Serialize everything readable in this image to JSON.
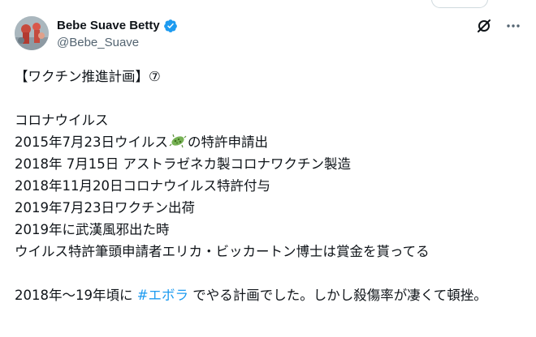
{
  "user": {
    "display_name": "Bebe Suave Betty",
    "handle": "@Bebe_Suave",
    "verified": true
  },
  "actions": {
    "grok_icon": "grok-slash-icon",
    "more_icon": "more-dots-icon"
  },
  "tweet": {
    "line1": "【ワクチン推進計画】⑦",
    "line2": "コロナウイルス",
    "line3_before": "2015年7月23日ウイルス",
    "line3_after": "の特許申請出",
    "line4": "2018年 7月15日 アストラゼネカ製コロナワクチン製造",
    "line5": "2018年11月20日コロナウイルス特許付与",
    "line6": "2019年7月23日ワクチン出荷",
    "line7": "2019年に武漢風邪出た時",
    "line8": "ウイルス特許筆頭申請者エリカ・ビッカートン博士は賞金を貰ってる",
    "line9_before": "2018年〜19年頃に ",
    "hashtag": "#エボラ",
    "line9_after": " でやる計画でした。しかし殺傷率が凄くて頓挫。",
    "emoji": "microbe-icon"
  },
  "colors": {
    "text": "#0f1419",
    "secondary": "#536471",
    "link": "#1d9bf0",
    "verified": "#1d9bf0"
  }
}
